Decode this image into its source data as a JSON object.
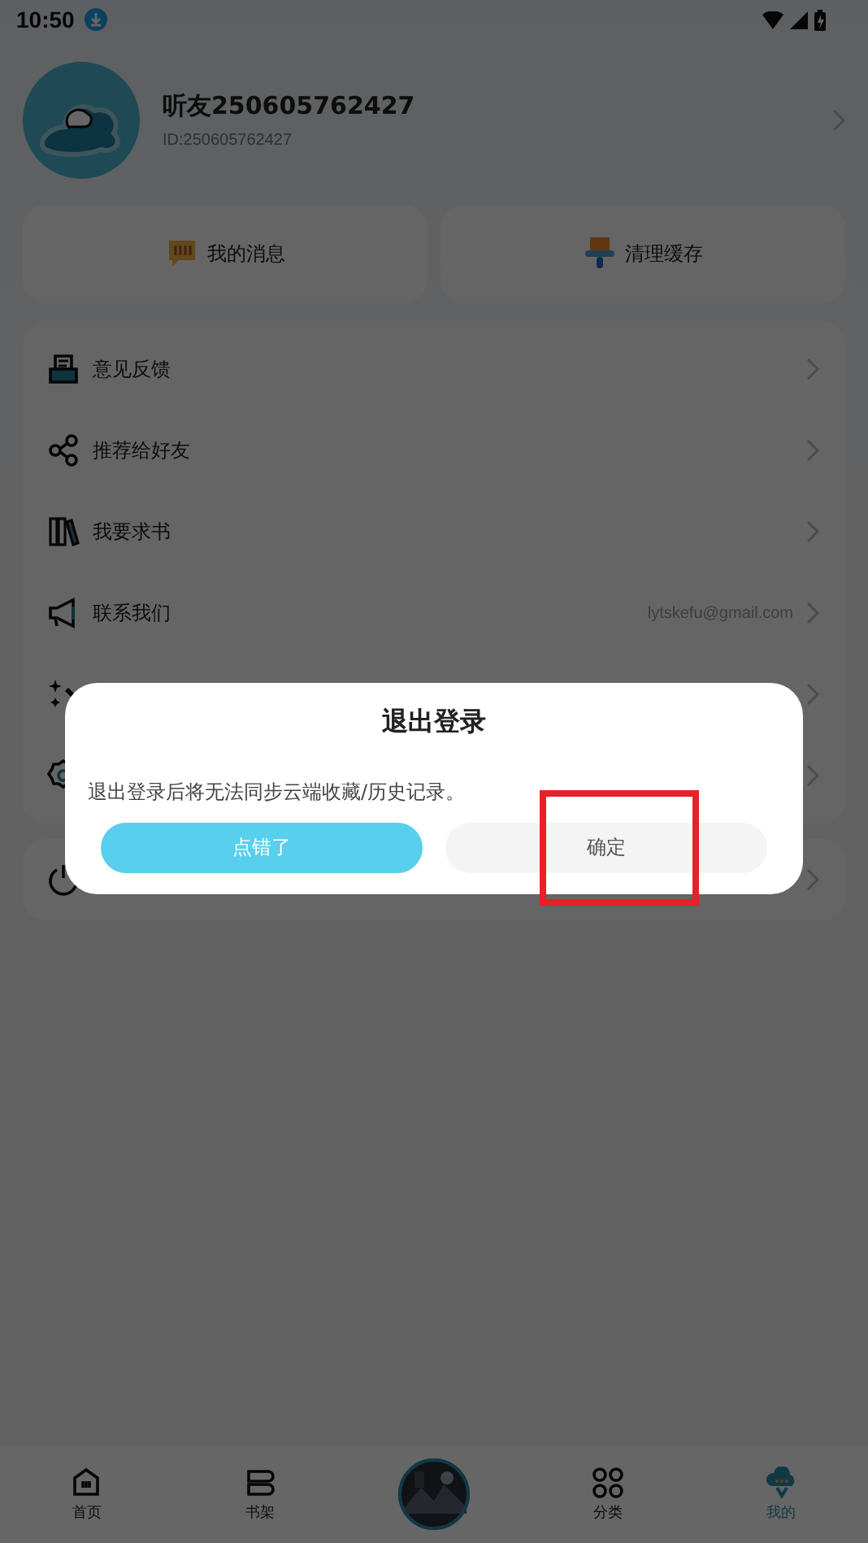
{
  "status_bar": {
    "time": "10:50"
  },
  "profile": {
    "name": "听友250605762427",
    "id": "ID:250605762427"
  },
  "quick_actions": [
    {
      "label": "我的消息"
    },
    {
      "label": "清理缓存"
    }
  ],
  "menu": [
    {
      "label": "意见反馈"
    },
    {
      "label": "推荐给好友"
    },
    {
      "label": "我要求书"
    },
    {
      "label": "联系我们",
      "value": "lytskefu@gmail.com"
    }
  ],
  "dialog": {
    "title": "退出登录",
    "message": "退出登录后将无法同步云端收藏/历史记录。",
    "buttons": [
      {
        "label": "点错了",
        "kind": "primary"
      },
      {
        "label": "确定",
        "kind": "secondary"
      }
    ]
  },
  "bottom_nav": [
    {
      "label": "首页",
      "selected": false
    },
    {
      "label": "书架",
      "selected": false
    },
    {
      "label": "分类",
      "selected": false
    },
    {
      "label": "我的",
      "selected": true
    }
  ]
}
